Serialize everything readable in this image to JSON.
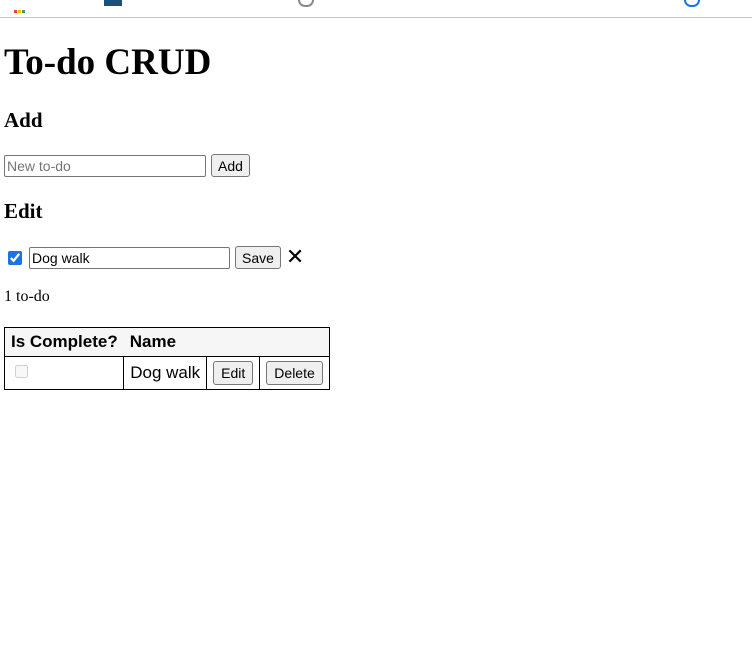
{
  "heading": "To-do CRUD",
  "add_section": {
    "title": "Add",
    "input_placeholder": "New to-do",
    "input_value": "",
    "button_label": "Add"
  },
  "edit_section": {
    "title": "Edit",
    "is_complete": true,
    "input_value": "Dog walk",
    "save_label": "Save",
    "close_glyph": "✕"
  },
  "count_text": "1 to-do",
  "table": {
    "headers": [
      "Is Complete?",
      "Name"
    ],
    "rows": [
      {
        "is_complete": false,
        "name": "Dog walk",
        "edit_label": "Edit",
        "delete_label": "Delete"
      }
    ]
  }
}
